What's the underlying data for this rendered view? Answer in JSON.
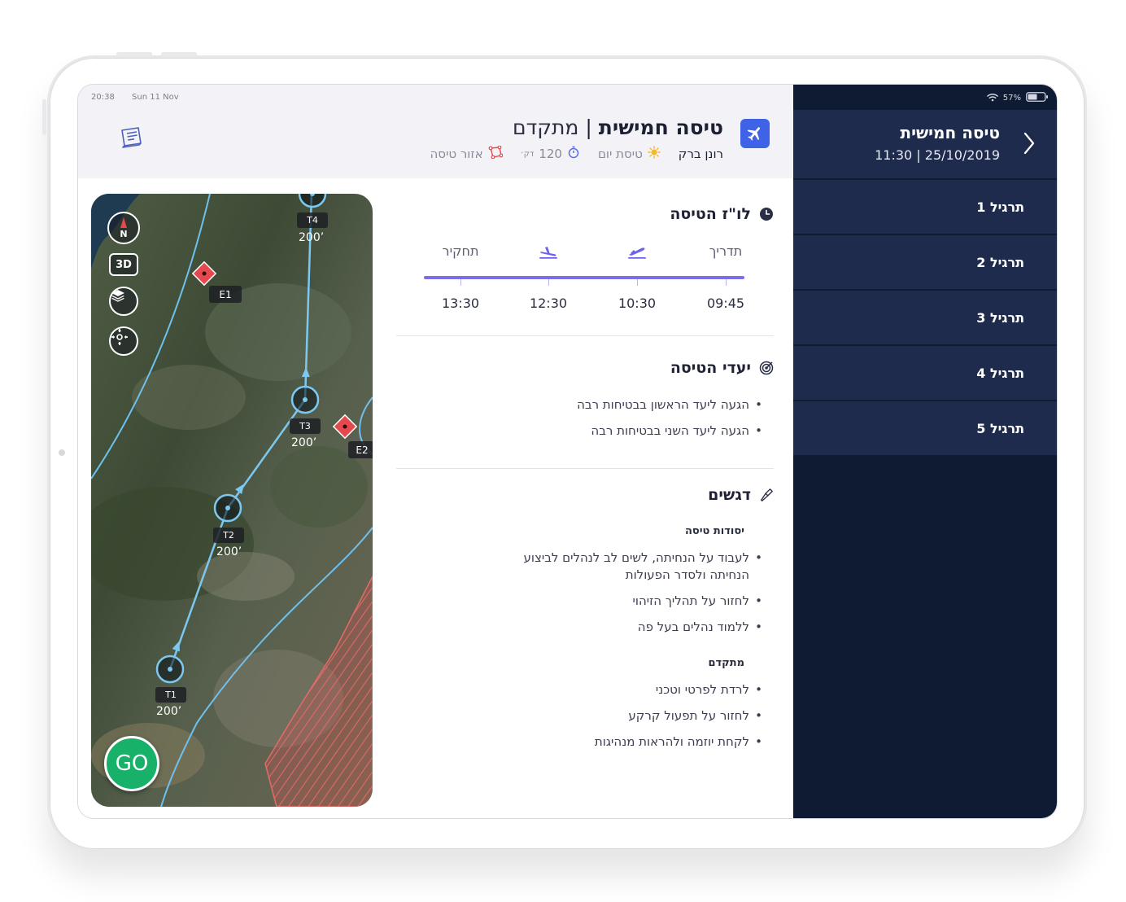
{
  "status": {
    "time": "20:38",
    "date": "Sun 11 Nov",
    "battery": "57%"
  },
  "header": {
    "title": "טיסה חמישית",
    "separator": "|",
    "level": "מתקדם",
    "pilot": "רונן ברק",
    "flight_type": "טיסת יום",
    "duration_value": "120",
    "duration_unit": "דק׳",
    "zone": "אזור טיסה"
  },
  "schedule": {
    "heading": "לו\"ז הטיסה",
    "stages": [
      {
        "label": "תדריך",
        "time": "09:45",
        "icon": "text"
      },
      {
        "label": "",
        "time": "10:30",
        "icon": "takeoff-icon"
      },
      {
        "label": "",
        "time": "12:30",
        "icon": "landing-icon"
      },
      {
        "label": "תחקיר",
        "time": "13:30",
        "icon": "text"
      }
    ]
  },
  "goals": {
    "heading": "יעדי הטיסה",
    "items": [
      "הגעה ליעד הראשון בבטיחות רבה",
      "הגעה ליעד השני בבטיחות רבה"
    ]
  },
  "emphases": {
    "heading": "דגשים",
    "groups": [
      {
        "title": "יסודות טיסה",
        "items": [
          "לעבוד על הנחיתה, לשים לב לנהלים לביצוע הנחיתה ולסדר הפעולות",
          "לחזור על תהליך הזיהוי",
          "ללמוד נהלים בעל פה"
        ]
      },
      {
        "title": "מתקדם",
        "items": [
          "לרדת לפרטי וטכני",
          "לחזור על תפעול קרקע",
          "לקחת יוזמה ולהראות מנהיגות"
        ]
      }
    ]
  },
  "map": {
    "compass": "N",
    "view_3d": "3D",
    "go": "GO",
    "waypoints": [
      {
        "label": "T1",
        "alt": "200’"
      },
      {
        "label": "T2",
        "alt": "200’"
      },
      {
        "label": "T3",
        "alt": "200’"
      },
      {
        "label": "T4",
        "alt": "200’"
      }
    ],
    "emergency_points": [
      {
        "label": "E1"
      },
      {
        "label": "E2"
      }
    ]
  },
  "sidebar": {
    "title": "טיסה חמישית",
    "subtitle": "11:30 | 25/10/2019",
    "items": [
      {
        "label": "תרגיל 1"
      },
      {
        "label": "תרגיל 2"
      },
      {
        "label": "תרגיל 3"
      },
      {
        "label": "תרגיל 4"
      },
      {
        "label": "תרגיל 5"
      }
    ]
  },
  "colors": {
    "accent": "#7b6fe8",
    "badge": "#3f63e6",
    "sidebar_bg": "#0f1a33",
    "sidebar_item": "#1e2b4d",
    "go": "#17b169",
    "danger": "#e5484d"
  }
}
